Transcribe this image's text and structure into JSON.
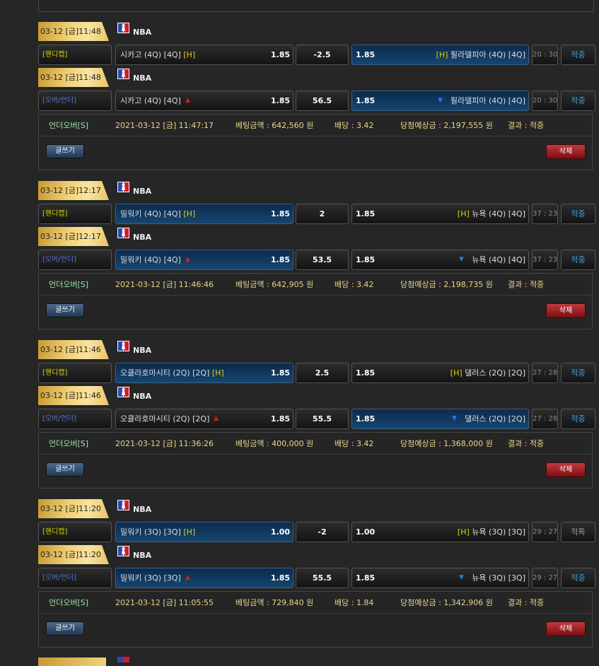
{
  "groups": [
    {
      "games": [
        {
          "datetime": "03-12 [금]11:48",
          "league": "NBA",
          "type": "[핸디캡]",
          "type_class": "hc",
          "home": {
            "name": "시카고 (4Q) [4Q]",
            "flag": "[H]",
            "arrow": "",
            "odds": "1.85",
            "selected": false
          },
          "line": "-2.5",
          "away": {
            "name": "필라델피아 (4Q) [4Q]",
            "flag": "[H]",
            "arrow": "",
            "odds": "1.85",
            "selected": true
          },
          "score": "20 : 30",
          "result": "적중",
          "result_hit": true
        },
        {
          "datetime": "03-12 [금]11:48",
          "league": "NBA",
          "type": "[오버/언더]",
          "type_class": "ou",
          "home": {
            "name": "시카고 (4Q) [4Q]",
            "flag": "",
            "arrow": "up",
            "odds": "1.85",
            "selected": false
          },
          "line": "56.5",
          "away": {
            "name": "필라델피아 (4Q) [4Q]",
            "flag": "",
            "arrow": "down",
            "odds": "1.85",
            "selected": true
          },
          "score": "20 : 30",
          "result": "적중",
          "result_hit": true
        }
      ],
      "info": {
        "bet_type": "언더오버[S]",
        "time": "2021-03-12 [금] 11:47:17",
        "amount": "베팅금액 : 642,560 원",
        "odds": "배당 : 3.42",
        "expected": "당첨예상금 : 2,197,555 원",
        "result": "결과 : 적중"
      },
      "write_label": "글쓰기",
      "delete_label": "삭제"
    },
    {
      "games": [
        {
          "datetime": "03-12 [금]12:17",
          "league": "NBA",
          "type": "[핸디캡]",
          "type_class": "hc",
          "home": {
            "name": "밀워키 (4Q) [4Q]",
            "flag": "[H]",
            "arrow": "",
            "odds": "1.85",
            "selected": true
          },
          "line": "2",
          "away": {
            "name": "뉴욕 (4Q) [4Q]",
            "flag": "[H]",
            "arrow": "",
            "odds": "1.85",
            "selected": false
          },
          "score": "37 : 23",
          "result": "적중",
          "result_hit": true
        },
        {
          "datetime": "03-12 [금]12:17",
          "league": "NBA",
          "type": "[오버/언더]",
          "type_class": "ou",
          "home": {
            "name": "밀워키 (4Q) [4Q]",
            "flag": "",
            "arrow": "up",
            "odds": "1.85",
            "selected": true
          },
          "line": "53.5",
          "away": {
            "name": "뉴욕 (4Q) [4Q]",
            "flag": "",
            "arrow": "down",
            "odds": "1.85",
            "selected": false
          },
          "score": "37 : 23",
          "result": "적중",
          "result_hit": true
        }
      ],
      "info": {
        "bet_type": "언더오버[S]",
        "time": "2021-03-12 [금] 11:46:46",
        "amount": "베팅금액 : 642,905 원",
        "odds": "배당 : 3.42",
        "expected": "당첨예상금 : 2,198,735 원",
        "result": "결과 : 적중"
      },
      "write_label": "글쓰기",
      "delete_label": "삭제"
    },
    {
      "games": [
        {
          "datetime": "03-12 [금]11:46",
          "league": "NBA",
          "type": "[핸디캡]",
          "type_class": "hc",
          "home": {
            "name": "오클라호마시티 (2Q) [2Q]",
            "flag": "[H]",
            "arrow": "",
            "odds": "1.85",
            "selected": true
          },
          "line": "2.5",
          "away": {
            "name": "댈러스 (2Q) [2Q]",
            "flag": "[H]",
            "arrow": "",
            "odds": "1.85",
            "selected": false
          },
          "score": "27 : 28",
          "result": "적중",
          "result_hit": true
        },
        {
          "datetime": "03-12 [금]11:46",
          "league": "NBA",
          "type": "[오버/언더]",
          "type_class": "ou",
          "home": {
            "name": "오클라호마시티 (2Q) [2Q]",
            "flag": "",
            "arrow": "up",
            "odds": "1.85",
            "selected": false
          },
          "line": "55.5",
          "away": {
            "name": "댈러스 (2Q) [2Q]",
            "flag": "",
            "arrow": "down",
            "odds": "1.85",
            "selected": true
          },
          "score": "27 : 28",
          "result": "적중",
          "result_hit": true
        }
      ],
      "info": {
        "bet_type": "언더오버[S]",
        "time": "2021-03-12 [금] 11:36:26",
        "amount": "베팅금액 : 400,000 원",
        "odds": "배당 : 3.42",
        "expected": "당첨예상금 : 1,368,000 원",
        "result": "결과 : 적중"
      },
      "write_label": "글쓰기",
      "delete_label": "삭제"
    },
    {
      "games": [
        {
          "datetime": "03-12 [금]11:20",
          "league": "NBA",
          "type": "[핸디캡]",
          "type_class": "hc",
          "home": {
            "name": "밀워키 (3Q) [3Q]",
            "flag": "[H]",
            "arrow": "",
            "odds": "1.00",
            "selected": true
          },
          "line": "-2",
          "away": {
            "name": "뉴욕 (3Q) [3Q]",
            "flag": "[H]",
            "arrow": "",
            "odds": "1.00",
            "selected": false
          },
          "score": "29 : 27",
          "result": "적특",
          "result_hit": false
        },
        {
          "datetime": "03-12 [금]11:20",
          "league": "NBA",
          "type": "[오버/언더]",
          "type_class": "ou",
          "home": {
            "name": "밀워키 (3Q) [3Q]",
            "flag": "",
            "arrow": "up",
            "odds": "1.85",
            "selected": true
          },
          "line": "55.5",
          "away": {
            "name": "뉴욕 (3Q) [3Q]",
            "flag": "",
            "arrow": "down",
            "odds": "1.85",
            "selected": false
          },
          "score": "29 : 27",
          "result": "적중",
          "result_hit": true
        }
      ],
      "info": {
        "bet_type": "언더오버[S]",
        "time": "2021-03-12 [금] 11:05:55",
        "amount": "베팅금액 : 729,840 원",
        "odds": "배당 : 1.84",
        "expected": "당첨예상금 : 1,342,906 원",
        "result": "결과 : 적중"
      },
      "write_label": "글쓰기",
      "delete_label": "삭제"
    }
  ]
}
